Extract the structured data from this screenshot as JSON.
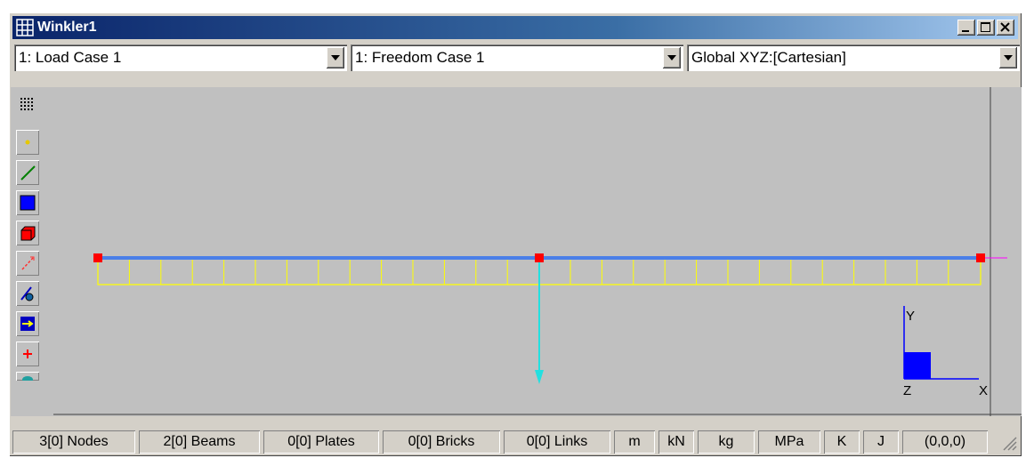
{
  "window": {
    "title": "Winkler1",
    "minimize_icon": "minimize-icon",
    "maximize_icon": "maximize-icon",
    "close_icon": "close-icon"
  },
  "selectors": {
    "load_case": "1: Load Case 1",
    "freedom_case": "1: Freedom Case 1",
    "coordinate_system": "Global XYZ:[Cartesian]"
  },
  "toolbar": {
    "tools": [
      "grid-dots-icon",
      "node-icon",
      "beam-icon",
      "plate-icon",
      "brick-icon",
      "link-icon",
      "attribute-icon",
      "load-arrow-icon",
      "add-icon",
      "globe-icon"
    ]
  },
  "scene": {
    "axes": {
      "y": "Y",
      "z": "Z",
      "x": "X"
    },
    "colors": {
      "beam": "#4a7fe8",
      "foundation": "#ffff00",
      "node": "#ff0000",
      "load": "#22e0e0",
      "axis": "#0000ff"
    }
  },
  "status": {
    "nodes": "3[0] Nodes",
    "beams": "2[0] Beams",
    "plates": "0[0] Plates",
    "bricks": "0[0] Bricks",
    "links": "0[0] Links",
    "length_unit": "m",
    "force_unit": "kN",
    "mass_unit": "kg",
    "stress_unit": "MPa",
    "temp_unit": "K",
    "energy_unit": "J",
    "coords": "(0,0,0)"
  }
}
